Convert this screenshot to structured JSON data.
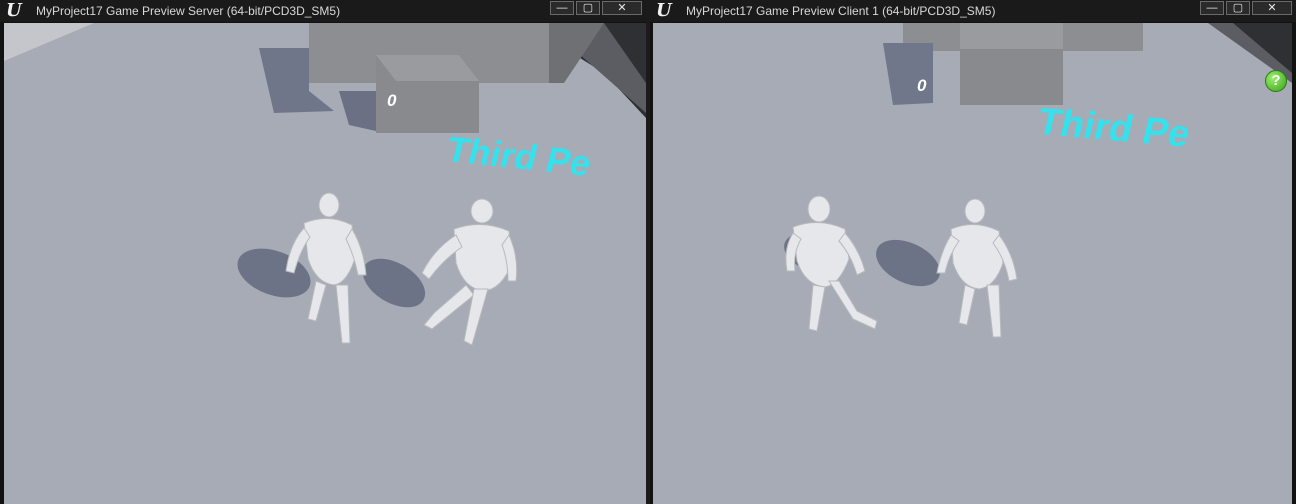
{
  "server_window": {
    "title": "MyProject17 Game Preview Server (64-bit/PCD3D_SM5)",
    "logo": "U",
    "controls": {
      "minimize": "—",
      "maximize": "▢",
      "close": "✕"
    },
    "score": "0",
    "floor_text": "Third Pe"
  },
  "client_window": {
    "title": "MyProject17 Game Preview Client 1 (64-bit/PCD3D_SM5)",
    "logo": "U",
    "controls": {
      "minimize": "—",
      "maximize": "▢",
      "close": "✕"
    },
    "score": "0",
    "floor_text": "Third Pe",
    "help_icon": "?"
  },
  "colors": {
    "floor": "#a7acb6",
    "floor_text": "#34e2ee",
    "block": "#8e8e8e",
    "mannequin": "#e9eaec",
    "shadow": "#6f7588"
  }
}
